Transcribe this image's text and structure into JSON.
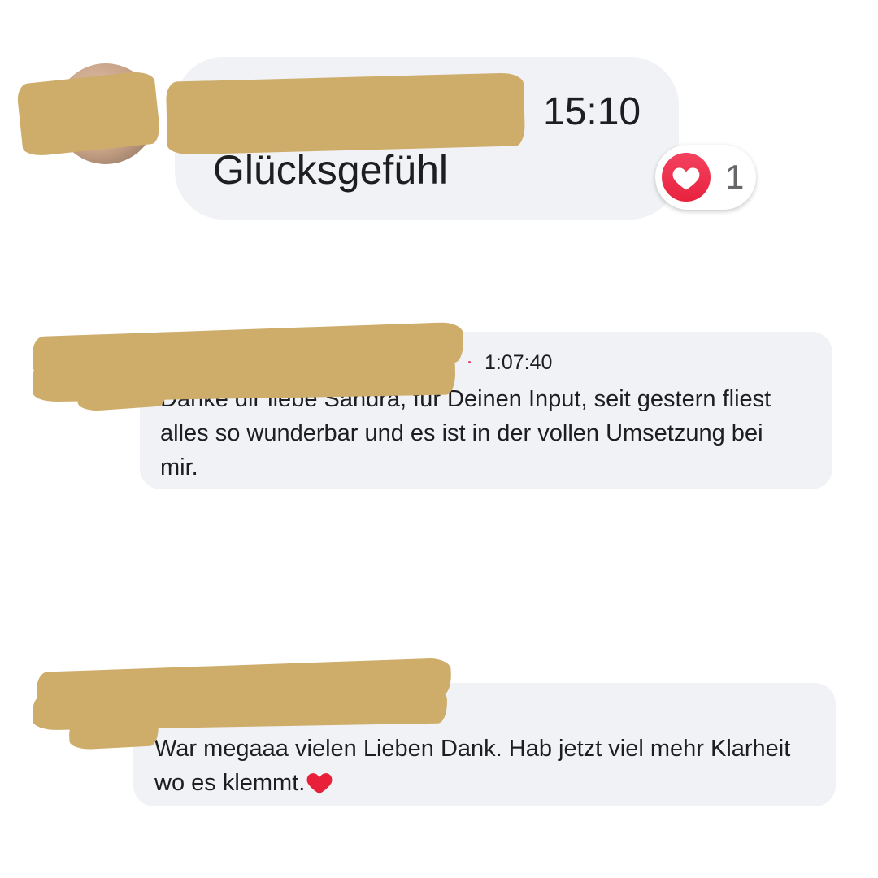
{
  "comments": [
    {
      "time": "15:10",
      "text": "Glücksgefühl",
      "reaction": {
        "icon": "heart-icon",
        "count": "1"
      }
    },
    {
      "time": "1:07:40",
      "text": "Danke dir liebe Sandra, für Deinen Input, seit gestern fliest alles so wunderbar und es ist in der vollen Umsetzung bei mir."
    },
    {
      "text": "War megaaa vielen Lieben Dank. Hab jetzt viel mehr Klarheit wo es klemmt.",
      "emoji": "heart-icon"
    }
  ],
  "colors": {
    "bubble": "#f0f2f5",
    "redaction": "#ceac6a",
    "reaction_red": "#f3425f",
    "text": "#1c1e21",
    "muted": "#65676b"
  }
}
